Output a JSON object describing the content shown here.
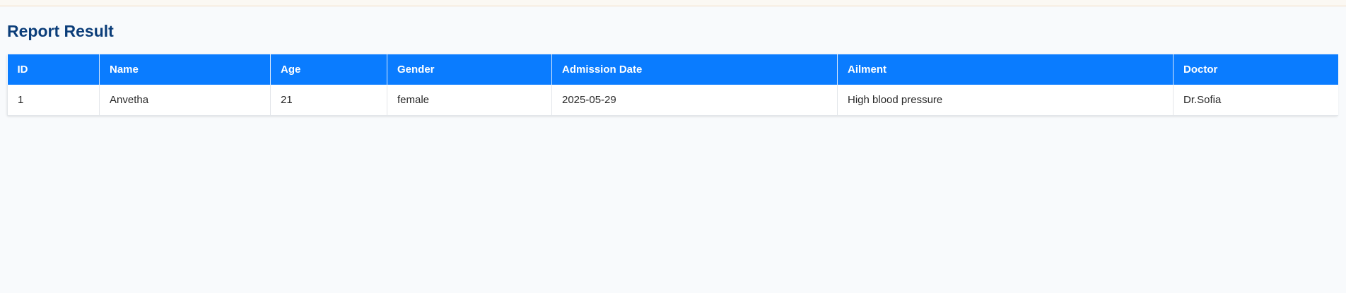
{
  "page": {
    "title": "Report Result"
  },
  "table": {
    "columns": [
      "ID",
      "Name",
      "Age",
      "Gender",
      "Admission Date",
      "Ailment",
      "Doctor"
    ],
    "rows": [
      [
        "1",
        "Anvetha",
        "21",
        "female",
        "2025-05-29",
        "High blood pressure",
        "Dr.Sofia"
      ]
    ]
  },
  "colors": {
    "header_bg": "#0a7cff",
    "title": "#0b3d79",
    "page_bg": "#f8fafc"
  }
}
